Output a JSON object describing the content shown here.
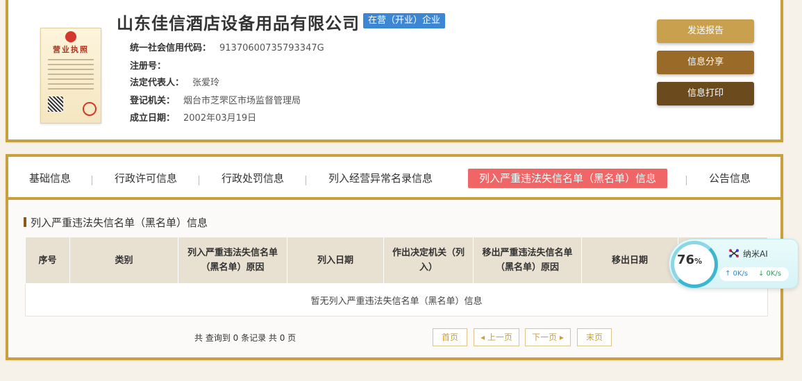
{
  "company": {
    "name": "山东佳信酒店设备用品有限公司",
    "status": "在营（开业）企业",
    "license_title": "营业执照",
    "fields": [
      {
        "label": "统一社会信用代码：",
        "value": "91370600735793347G"
      },
      {
        "label": "注册号：",
        "value": ""
      },
      {
        "label": "法定代表人：",
        "value": "张爱玲"
      },
      {
        "label": "登记机关：",
        "value": "烟台市芝罘区市场监督管理局"
      },
      {
        "label": "成立日期：",
        "value": "2002年03月19日"
      }
    ]
  },
  "actions": {
    "send_report": "发送报告",
    "share": "信息分享",
    "print": "信息打印"
  },
  "tabs": [
    {
      "label": "基础信息"
    },
    {
      "label": "行政许可信息"
    },
    {
      "label": "行政处罚信息"
    },
    {
      "label": "列入经营异常名录信息"
    },
    {
      "label": "列入严重违法失信名单（黑名单）信息",
      "active": true
    },
    {
      "label": "公告信息"
    }
  ],
  "section": {
    "title": "列入严重违法失信名单（黑名单）信息",
    "columns": [
      "序号",
      "类别",
      "列入严重违法失信名单（黑名单）原因",
      "列入日期",
      "作出决定机关（列入）",
      "移出严重违法失信名单（黑名单）原因",
      "移出日期",
      ""
    ],
    "empty_text": "暂无列入严重违法失信名单（黑名单）信息"
  },
  "pagination": {
    "summary": "共 查询到 0 条记录 共 0 页",
    "first": "首页",
    "prev": "◂ 上一页",
    "next": "下一页 ▸",
    "last": "末页"
  },
  "widget": {
    "percent": "76",
    "percent_unit": "%",
    "label": "纳米AI",
    "upload": "↑ 0K/s",
    "download": "↓ 0K/s"
  },
  "colors": {
    "gold": "#c9a13c",
    "badge_blue": "#3c87d4",
    "active_tab": "#f06565",
    "btn_report": "#c9a04e",
    "btn_share": "#9a6a28",
    "btn_print": "#6b4a1e"
  }
}
